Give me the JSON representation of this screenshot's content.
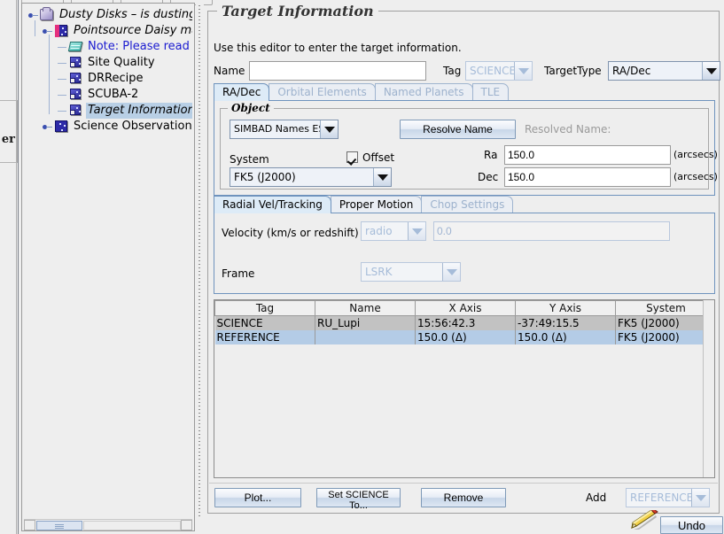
{
  "window": {
    "partial_left_label": "er"
  },
  "tree": {
    "nodes": [
      {
        "label": "Dusty Disks – is dusting a",
        "icon": "folder-icon",
        "style": "italic",
        "indent": 0,
        "toggle": "expanded"
      },
      {
        "label": "Pointsource Daisy map",
        "icon": "cube-icon",
        "style": "italic",
        "indent": 1,
        "toggle": "expanded"
      },
      {
        "label": "Note: Please read",
        "icon": "note-icon",
        "style": "note",
        "indent": 2,
        "toggle": "none"
      },
      {
        "label": "Site Quality",
        "icon": "component-icon",
        "style": "plain",
        "indent": 2,
        "toggle": "none"
      },
      {
        "label": "DRRecipe",
        "icon": "component-icon",
        "style": "plain",
        "indent": 2,
        "toggle": "none"
      },
      {
        "label": "SCUBA-2",
        "icon": "component-icon",
        "style": "plain",
        "indent": 2,
        "toggle": "none"
      },
      {
        "label": "Target Information:",
        "icon": "component-icon",
        "style": "selected",
        "indent": 2,
        "toggle": "none"
      },
      {
        "label": "Science Observation",
        "icon": "cube-icon",
        "style": "plain",
        "indent": 1,
        "toggle": "collapsed"
      }
    ]
  },
  "editor": {
    "title": "Target Information",
    "hint": "Use this editor to enter the target information.",
    "name_label": "Name",
    "name_value": "",
    "tag_label": "Tag",
    "tag_value": "SCIENCE",
    "targettype_label": "TargetType",
    "targettype_value": "RA/Dec",
    "tabs": [
      {
        "label": "RA/Dec",
        "active": true
      },
      {
        "label": "Orbital Elements",
        "active": false
      },
      {
        "label": "Named Planets",
        "active": false
      },
      {
        "label": "TLE",
        "active": false
      }
    ],
    "object": {
      "title": "Object",
      "catalog_value": "SIMBAD Names ESO",
      "resolve_button": "Resolve Name",
      "resolved_name_label": "Resolved Name:",
      "system_label": "System",
      "system_value": "FK5 (J2000)",
      "offset_label": "Offset",
      "offset_checked": true,
      "ra_label": "Ra",
      "ra_value": "150.0",
      "ra_units": "(arcsecs)",
      "dec_label": "Dec",
      "dec_value": "150.0",
      "dec_units": "(arcsecs)"
    },
    "lower_tabs": [
      {
        "label": "Radial Vel/Tracking",
        "active": true,
        "enabled": true
      },
      {
        "label": "Proper Motion",
        "active": false,
        "enabled": true
      },
      {
        "label": "Chop Settings",
        "active": false,
        "enabled": false
      }
    ],
    "radial": {
      "velocity_label": "Velocity (km/s or redshift)",
      "velocity_type": "radio",
      "velocity_value": "0.0",
      "frame_label": "Frame",
      "frame_value": "LSRK"
    },
    "table": {
      "columns": [
        "Tag",
        "Name",
        "X Axis",
        "Y Axis",
        "System"
      ],
      "rows": [
        {
          "state": "science",
          "cells": [
            "SCIENCE",
            "RU_Lupi",
            "15:56:42.3",
            "-37:49:15.5",
            "FK5 (J2000)"
          ]
        },
        {
          "state": "reference",
          "cells": [
            "REFERENCE",
            "",
            "150.0 (Δ)",
            "150.0 (Δ)",
            "FK5 (J2000)"
          ]
        }
      ]
    },
    "buttons": {
      "plot": "Plot...",
      "set_science_to": "Set SCIENCE To...",
      "remove": "Remove",
      "add_label": "Add",
      "add_value": "REFERENCE"
    }
  },
  "footer": {
    "undo_label": "Undo",
    "pencil_icon": "pencil-icon"
  },
  "colors": {
    "accent_blue": "#b8cfe5",
    "note_text": "#1b1bd0",
    "row_science": "#c2c2c2",
    "row_reference": "#b4cce6",
    "tab_active": "#ddebf7",
    "disabled_text": "#a6bcd9"
  }
}
